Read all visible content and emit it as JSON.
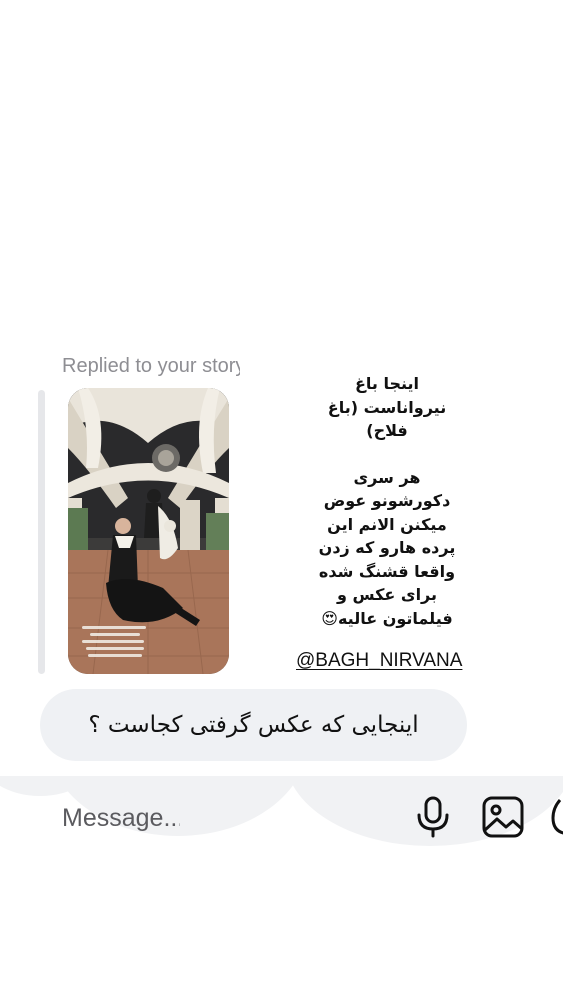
{
  "reply_context": {
    "label": "Replied to your story"
  },
  "story_caption": {
    "lines_block1": [
      "اینجا باغ",
      "نیرواناست (باغ",
      "فلاح)"
    ],
    "lines_block2": [
      "هر سری",
      "دکورشونو عوض",
      "میکنن الانم این",
      "پرده هارو که زدن",
      "واقعا قشنگ شده",
      "برای عکس و",
      "فیلماتون عالیه😍"
    ],
    "handle": "@BAGH_NIRVANA"
  },
  "message": {
    "text": "اینجایی که عکس گرفتی کجاست ؟"
  },
  "composer": {
    "placeholder": "Message..."
  },
  "icons": {
    "mic": "microphone-icon",
    "gallery": "gallery-icon",
    "sticker": "sticker-icon"
  },
  "colors": {
    "bubble_bg": "#eff1f4",
    "reply_bar": "#e6e7ea",
    "muted_text": "#8e8e93"
  }
}
